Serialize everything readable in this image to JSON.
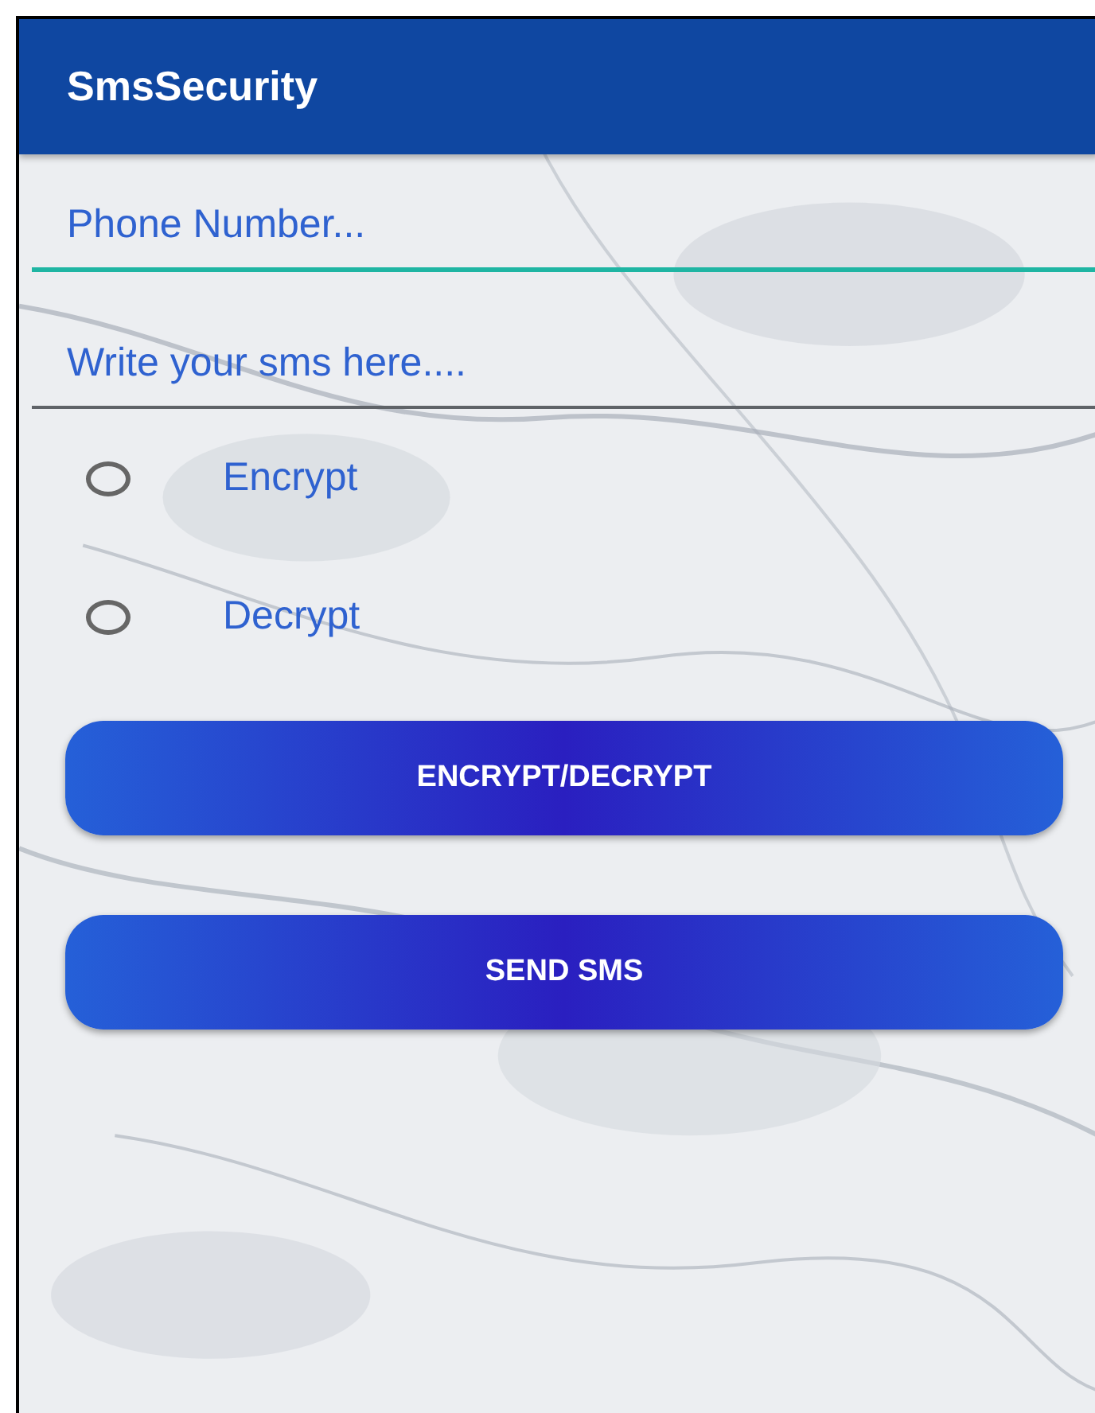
{
  "app_bar": {
    "title": "SmsSecurity"
  },
  "fields": [
    {
      "placeholder": "Phone Number...",
      "focused": true
    },
    {
      "placeholder": "Write your sms here....",
      "focused": false
    }
  ],
  "radios": [
    {
      "label": "Encrypt",
      "selected": false
    },
    {
      "label": "Decrypt",
      "selected": false
    }
  ],
  "buttons": [
    "ENCRYPT/DECRYPT",
    "SEND SMS"
  ]
}
